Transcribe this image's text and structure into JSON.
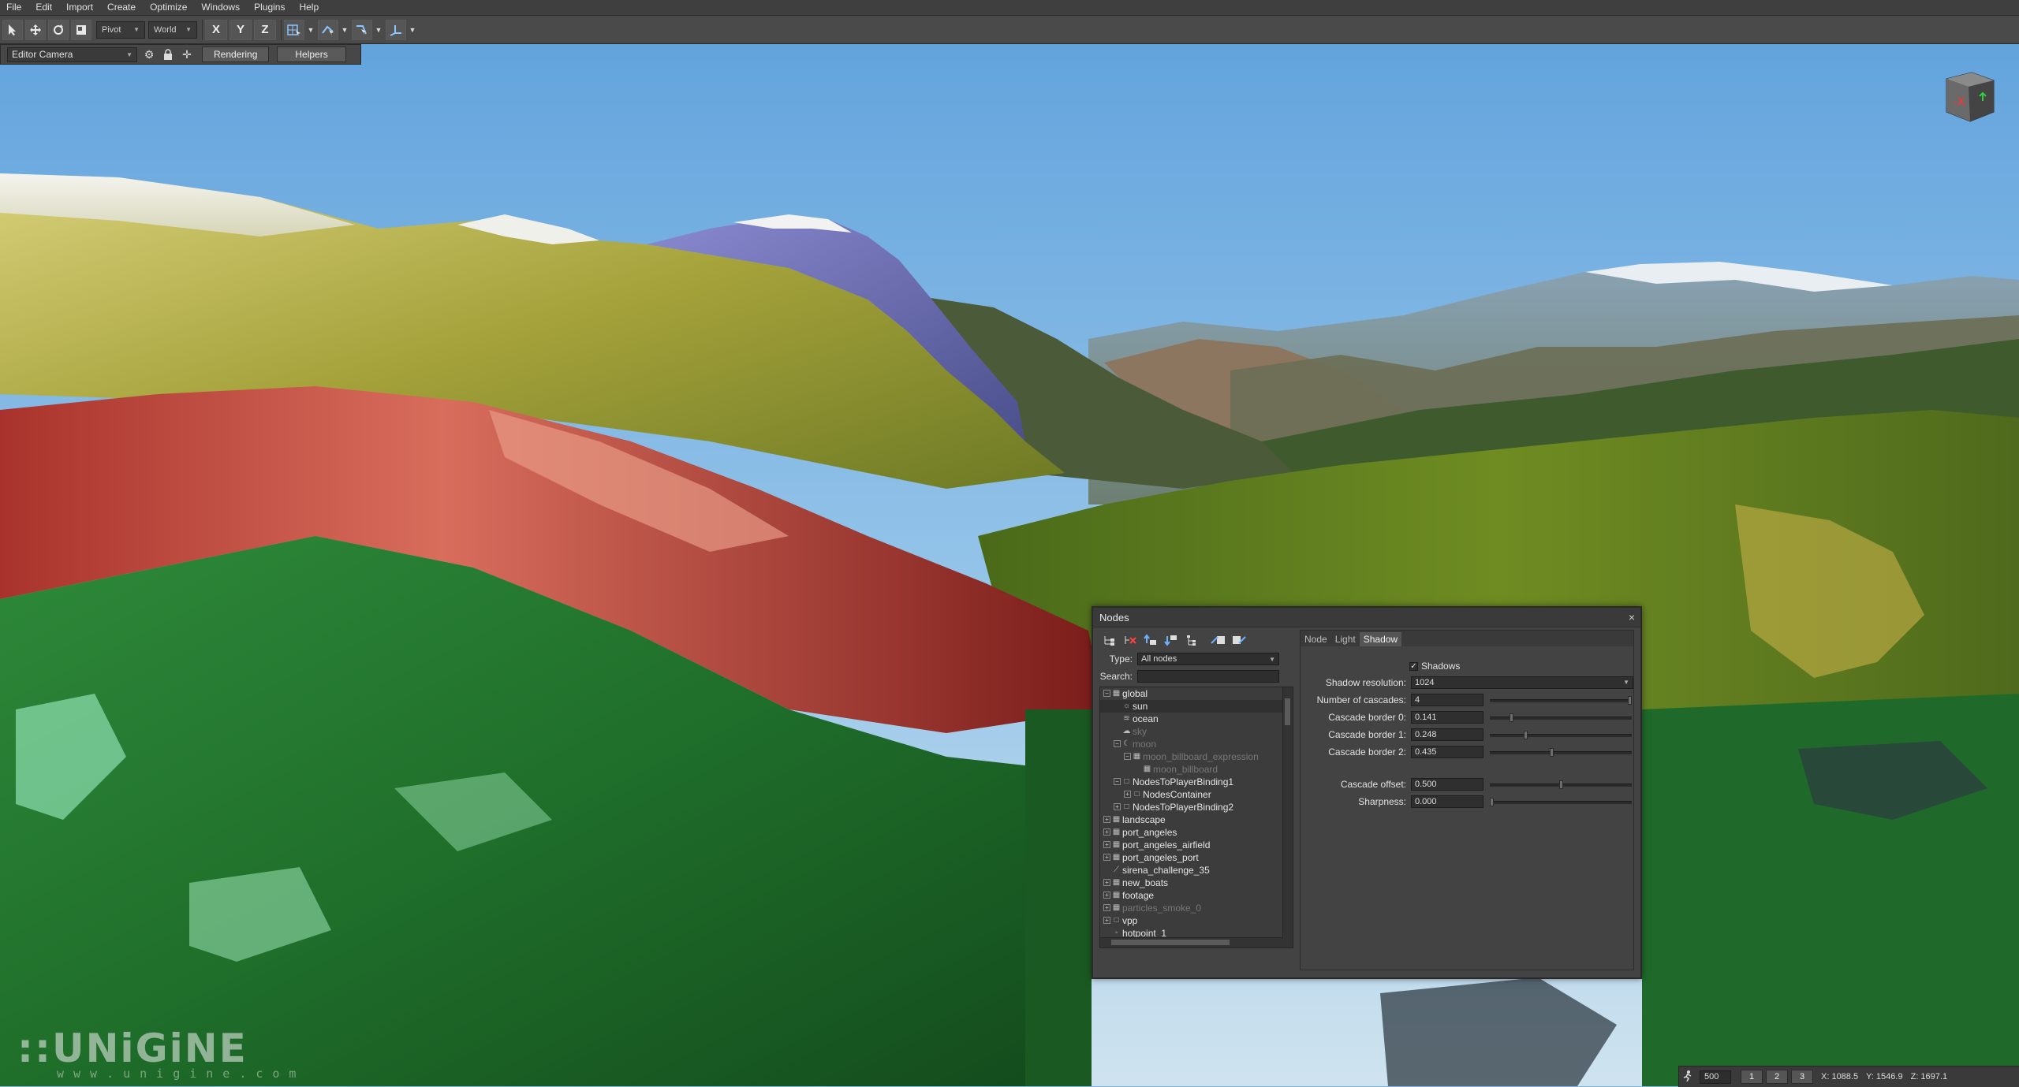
{
  "menubar": {
    "items": [
      "File",
      "Edit",
      "Import",
      "Create",
      "Optimize",
      "Windows",
      "Plugins",
      "Help"
    ]
  },
  "toolbar": {
    "pivot_label": "Pivot",
    "world_label": "World",
    "axis_x": "X",
    "axis_y": "Y",
    "axis_z": "Z"
  },
  "camerabar": {
    "camera": "Editor Camera",
    "rendering_label": "Rendering",
    "helpers_label": "Helpers"
  },
  "viewcube": {
    "label": "-X",
    "colors": {
      "x": "#ff3030",
      "y": "#30d040"
    }
  },
  "nodes_window": {
    "title": "Nodes",
    "close": "×",
    "type_label": "Type:",
    "type_value": "All nodes",
    "search_label": "Search:",
    "search_value": "",
    "tree": [
      {
        "label": "global",
        "state": "normal"
      },
      {
        "label": "sun",
        "state": "selected"
      },
      {
        "label": "ocean",
        "state": "normal"
      },
      {
        "label": "sky",
        "state": "dim"
      },
      {
        "label": "moon",
        "state": "dim"
      },
      {
        "label": "moon_billboard_expression",
        "state": "dim"
      },
      {
        "label": "moon_billboard",
        "state": "dim"
      },
      {
        "label": "NodesToPlayerBinding1",
        "state": "normal"
      },
      {
        "label": "NodesContainer",
        "state": "normal"
      },
      {
        "label": "NodesToPlayerBinding2",
        "state": "normal"
      },
      {
        "label": "landscape",
        "state": "normal"
      },
      {
        "label": "port_angeles",
        "state": "normal"
      },
      {
        "label": "port_angeles_airfield",
        "state": "normal"
      },
      {
        "label": "port_angeles_port",
        "state": "normal"
      },
      {
        "label": "sirena_challenge_35",
        "state": "normal"
      },
      {
        "label": "new_boats",
        "state": "normal"
      },
      {
        "label": "footage",
        "state": "normal"
      },
      {
        "label": "particles_smoke_0",
        "state": "dim"
      },
      {
        "label": "vpp",
        "state": "normal"
      },
      {
        "label": "hotpoint_1",
        "state": "normal"
      },
      {
        "label": "hotpoint_2",
        "state": "normal"
      }
    ],
    "tabs": [
      "Node",
      "Light",
      "Shadow"
    ],
    "active_tab": "Shadow",
    "shadow": {
      "shadows_label": "Shadows",
      "shadows_checked": "✓",
      "resolution_label": "Shadow resolution:",
      "resolution_value": "1024",
      "cascades_label": "Number of cascades:",
      "cascades_value": "4",
      "cascades_fraction": 1.0,
      "border0_label": "Cascade border 0:",
      "border0_value": "0.141",
      "border1_label": "Cascade border 1:",
      "border1_value": "0.248",
      "border2_label": "Cascade border 2:",
      "border2_value": "0.435",
      "offset_label": "Cascade offset:",
      "offset_value": "0.500",
      "sharpness_label": "Sharpness:",
      "sharpness_value": "0.000"
    }
  },
  "statusbar": {
    "speed": "500",
    "btn1": "1",
    "btn2": "2",
    "btn3": "3",
    "x": "X: 1088.5",
    "y": "Y: 1546.9",
    "z": "Z: 1697.1"
  },
  "logo": {
    "text": "::UNiGiNE",
    "subtitle": "www.unigine.com"
  }
}
